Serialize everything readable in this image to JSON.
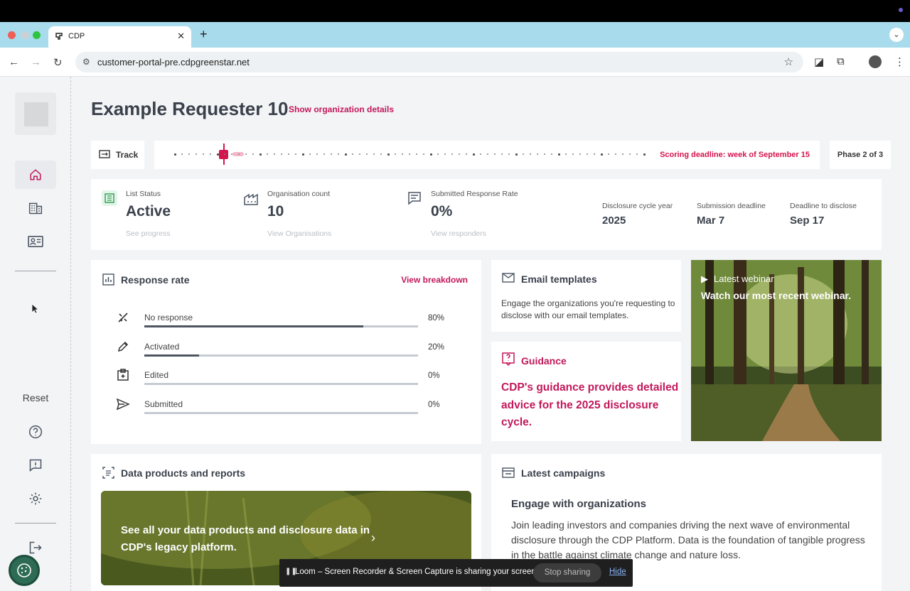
{
  "browser": {
    "tab_title": "CDP",
    "new_tab": "+",
    "tab_close": "✕",
    "url": "customer-portal-pre.cdpgreenstar.net"
  },
  "sidebar": {
    "reset_label": "Reset",
    "items": [
      "home-icon",
      "buildings-icon",
      "contact-card-icon"
    ],
    "bottom_items": [
      "help-icon",
      "feedback-icon",
      "settings-icon",
      "logout-icon"
    ]
  },
  "header": {
    "title": "Example Requester 10",
    "details_link": "Show organization details"
  },
  "track": {
    "label": "Track",
    "deadline": "Scoring deadline: week of September 15",
    "phase": "Phase 2 of 3"
  },
  "stats": {
    "list_status": {
      "label": "List Status",
      "value": "Active",
      "sub": "See progress"
    },
    "org_count": {
      "label": "Organisation count",
      "value": "10",
      "sub": "View Organisations"
    },
    "response_rate": {
      "label": "Submitted Response Rate",
      "value": "0%",
      "sub": "View responders"
    },
    "cycle_year": {
      "label": "Disclosure cycle year",
      "value": "2025"
    },
    "submission_deadline": {
      "label": "Submission deadline",
      "value": "Mar 7"
    },
    "disclose_deadline": {
      "label": "Deadline to disclose",
      "value": "Sep 17"
    }
  },
  "response_rate": {
    "title": "Response rate",
    "link": "View breakdown",
    "rows": [
      {
        "label": "No response",
        "pct": "80%",
        "fraction": 0.8,
        "icon": "no-response-icon"
      },
      {
        "label": "Activated",
        "pct": "20%",
        "fraction": 0.2,
        "icon": "pencil-icon"
      },
      {
        "label": "Edited",
        "pct": "0%",
        "fraction": 0,
        "icon": "edited-icon"
      },
      {
        "label": "Submitted",
        "pct": "0%",
        "fraction": 0,
        "icon": "send-icon"
      }
    ]
  },
  "email_templates": {
    "title": "Email templates",
    "desc": "Engage the organizations you're requesting to disclose with our email templates."
  },
  "guidance": {
    "title": "Guidance",
    "text": "CDP's guidance provides detailed advice for the 2025 disclosure cycle."
  },
  "webinar": {
    "label": "Latest webinar",
    "text": "Watch our most recent webinar."
  },
  "data_products": {
    "title": "Data products and reports",
    "banner": "See all your data products and disclosure data in CDP's legacy platform."
  },
  "campaigns": {
    "title": "Latest campaigns",
    "headline": "Engage with organizations",
    "text": "Join leading investors and companies driving the next wave of environmental disclosure through the CDP Platform. Data is the foundation of tangible progress in the battle against climate change and nature loss."
  },
  "loom": {
    "message": "Loom – Screen Recorder & Screen Capture is sharing your screen.",
    "stop": "Stop sharing",
    "hide": "Hide"
  },
  "colors": {
    "accent": "#c2185b",
    "timeline_marker": "#d5134d"
  }
}
